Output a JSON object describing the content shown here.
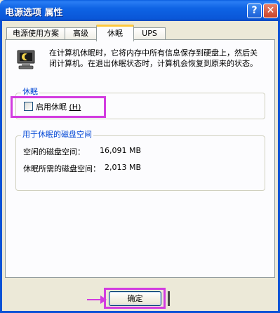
{
  "window": {
    "title": "电源选项 属性",
    "help_label": "?",
    "close_label": "✕"
  },
  "tabs": [
    {
      "label": "电源使用方案",
      "active": false
    },
    {
      "label": "高级",
      "active": false
    },
    {
      "label": "休眠",
      "active": true
    },
    {
      "label": "UPS",
      "active": false
    }
  ],
  "description": "在计算机休眠时，它将内存中所有信息保存到硬盘上，然后关闭计算机。在退出休眠状态时，计算机会恢复到原来的状态。",
  "icon": "battery-computer-icon",
  "hibernate_group": {
    "title": "休眠",
    "checkbox_label": "启用休眠",
    "checkbox_accel": "(H)",
    "checked": false
  },
  "disk_group": {
    "title": "用于休眠的磁盘空间",
    "free_label": "空闲的磁盘空间：",
    "free_value": "16,091 MB",
    "required_label": "休眠所需的磁盘空间：",
    "required_value": "2,013 MB"
  },
  "footer": {
    "ok_label": "确定"
  },
  "colors": {
    "titlebar": "#0a5ee0",
    "highlight": "#d23ce0",
    "group_title": "#0046d5",
    "tab_active_accent": "#ffc83c"
  }
}
